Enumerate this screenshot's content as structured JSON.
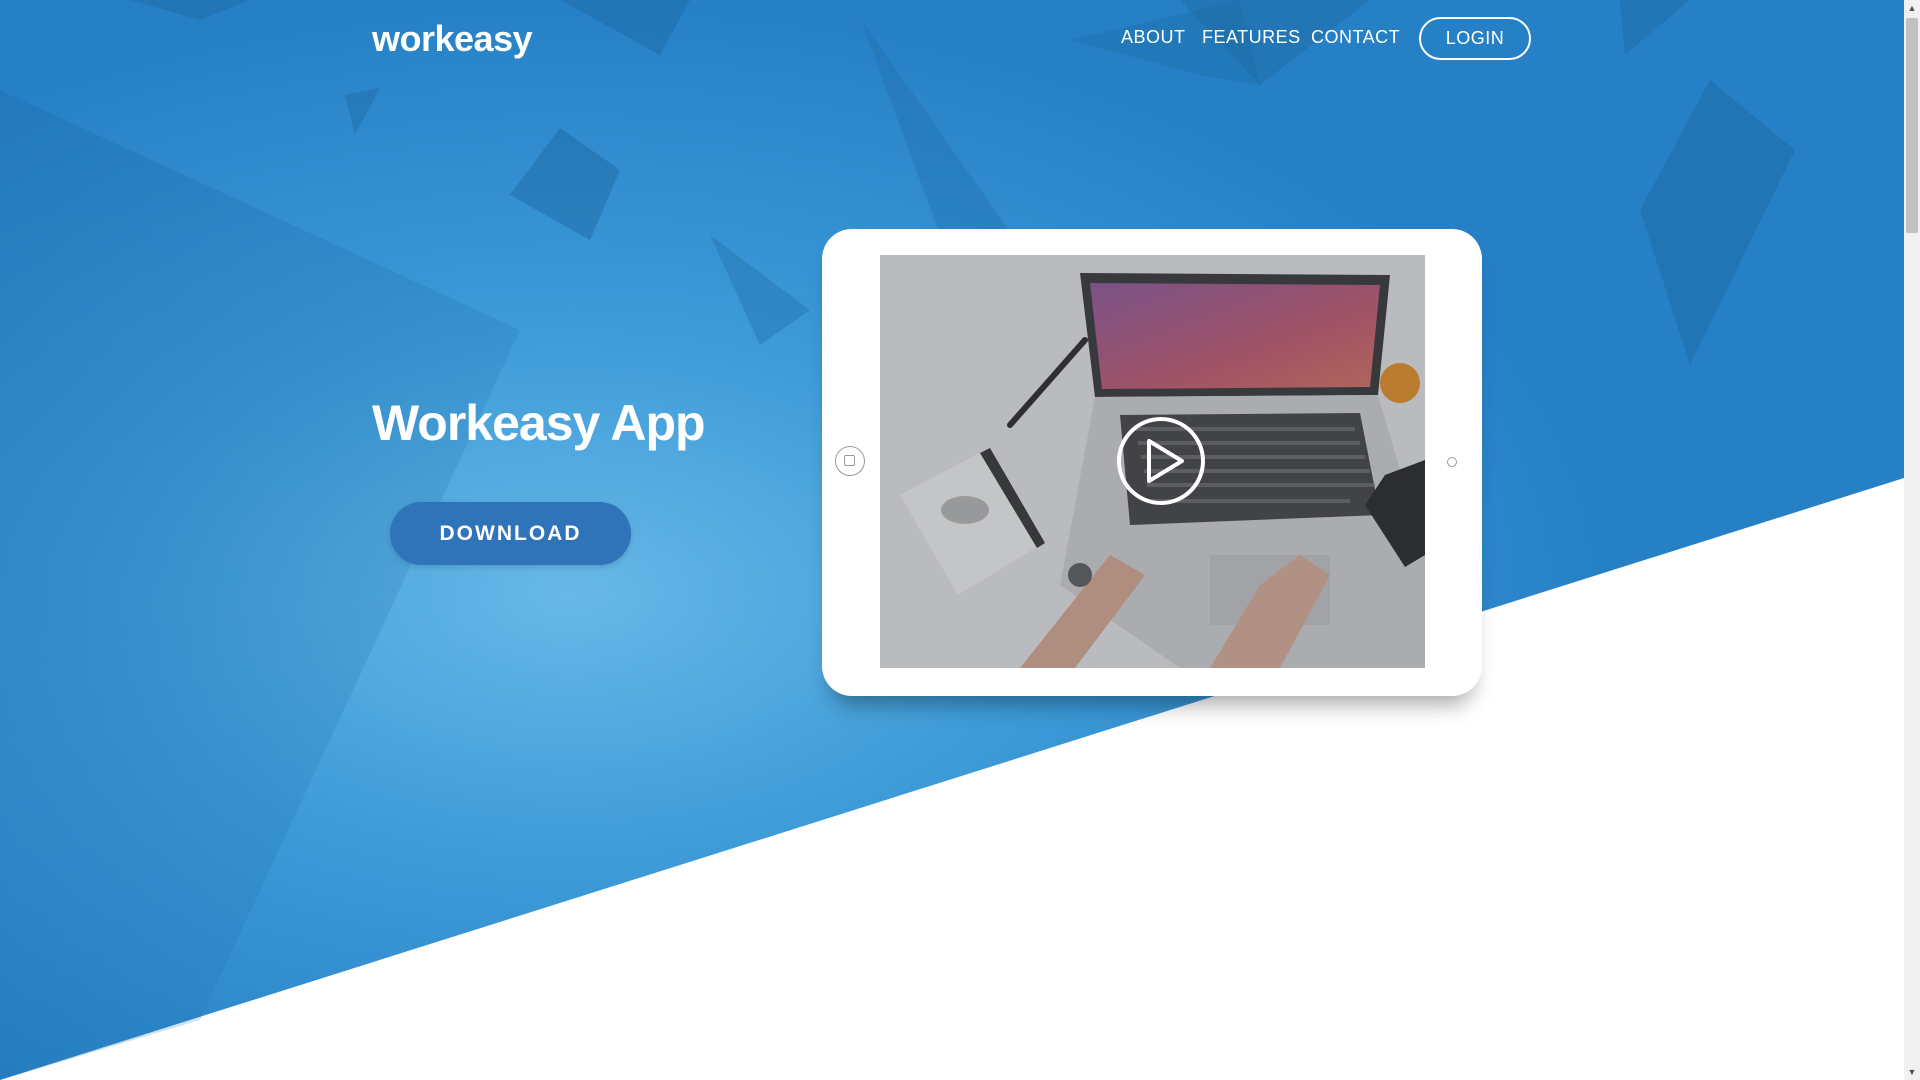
{
  "brand": {
    "name": "workeasy"
  },
  "nav": {
    "links": [
      {
        "label": "ABOUT"
      },
      {
        "label": "FEATURES"
      },
      {
        "label": "CONTACT"
      }
    ],
    "login_label": "LOGIN"
  },
  "hero": {
    "title": "Workeasy App",
    "download_label": "DOWNLOAD"
  },
  "video": {
    "play_icon": "play-circle-icon"
  },
  "colors": {
    "hero_blue": "#2b8fd6",
    "hero_dark_blue": "#1f6ea8",
    "button_blue": "#2f73b9",
    "white": "#ffffff"
  },
  "scrollbar": {
    "up_icon": "▲",
    "down_icon": "▼"
  }
}
